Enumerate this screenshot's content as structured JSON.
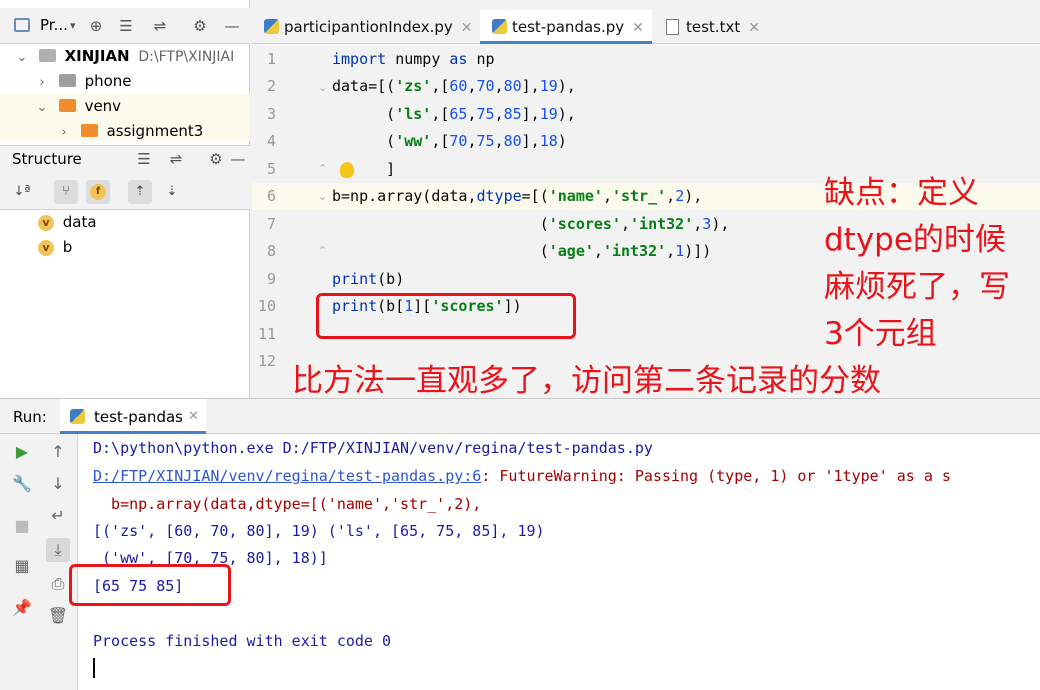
{
  "project_panel": {
    "title": "Pr...",
    "tree": [
      {
        "label": "XINJIAN",
        "path": "D:\\FTP\\XINJIAI"
      },
      {
        "label": "phone"
      },
      {
        "label": "venv"
      },
      {
        "label": "assignment3"
      }
    ]
  },
  "structure_panel": {
    "title": "Structure",
    "items": [
      {
        "badge": "v",
        "label": "data"
      },
      {
        "badge": "v",
        "label": "b"
      }
    ]
  },
  "editor": {
    "tabs": [
      {
        "label": "participantionIndex.py",
        "type": "py",
        "active": false
      },
      {
        "label": "test-pandas.py",
        "type": "py",
        "active": true
      },
      {
        "label": "test.txt",
        "type": "txt",
        "active": false
      }
    ],
    "line_numbers": [
      "1",
      "2",
      "3",
      "4",
      "5",
      "6",
      "7",
      "8",
      "9",
      "10",
      "11",
      "12"
    ],
    "lines": [
      "import numpy as np",
      "data=[('zs',[60,70,80],19),",
      "      ('ls',[65,75,85],19),",
      "      ('ww',[70,75,80],18)",
      "      ]",
      "b=np.array(data,dtype=[('name','str_',2),",
      "                       ('scores','int32',3),",
      "                       ('age','int32',1)])",
      "print(b)",
      "print(b[1]['scores'])",
      "",
      ""
    ]
  },
  "annotations": {
    "right_note": [
      "缺点：定义",
      "dtype的时候",
      "麻烦死了，写",
      "3个元组"
    ],
    "bottom_note": "比方法一直观多了，访问第二条记录的分数"
  },
  "run_panel": {
    "label": "Run:",
    "tab": "test-pandas",
    "console": [
      "D:\\python\\python.exe D:/FTP/XINJIAN/venv/regina/test-pandas.py",
      "D:/FTP/XINJIAN/venv/regina/test-pandas.py:6",
      ": FutureWarning: Passing (type, 1) or '1type' as a s",
      "  b=np.array(data,dtype=[('name','str_',2),",
      "[('zs', [60, 70, 80], 19) ('ls', [65, 75, 85], 19)",
      " ('ww', [70, 75, 80], 18)]",
      "[65 75 85]",
      "Process finished with exit code 0"
    ]
  },
  "colors": {
    "annotation_red": "#e8141a",
    "keyword": "#0033b3",
    "string": "#067d17",
    "number": "#1750eb",
    "link": "#2c55d1",
    "warning": "#a30000",
    "console_text": "#1a1aa6"
  }
}
